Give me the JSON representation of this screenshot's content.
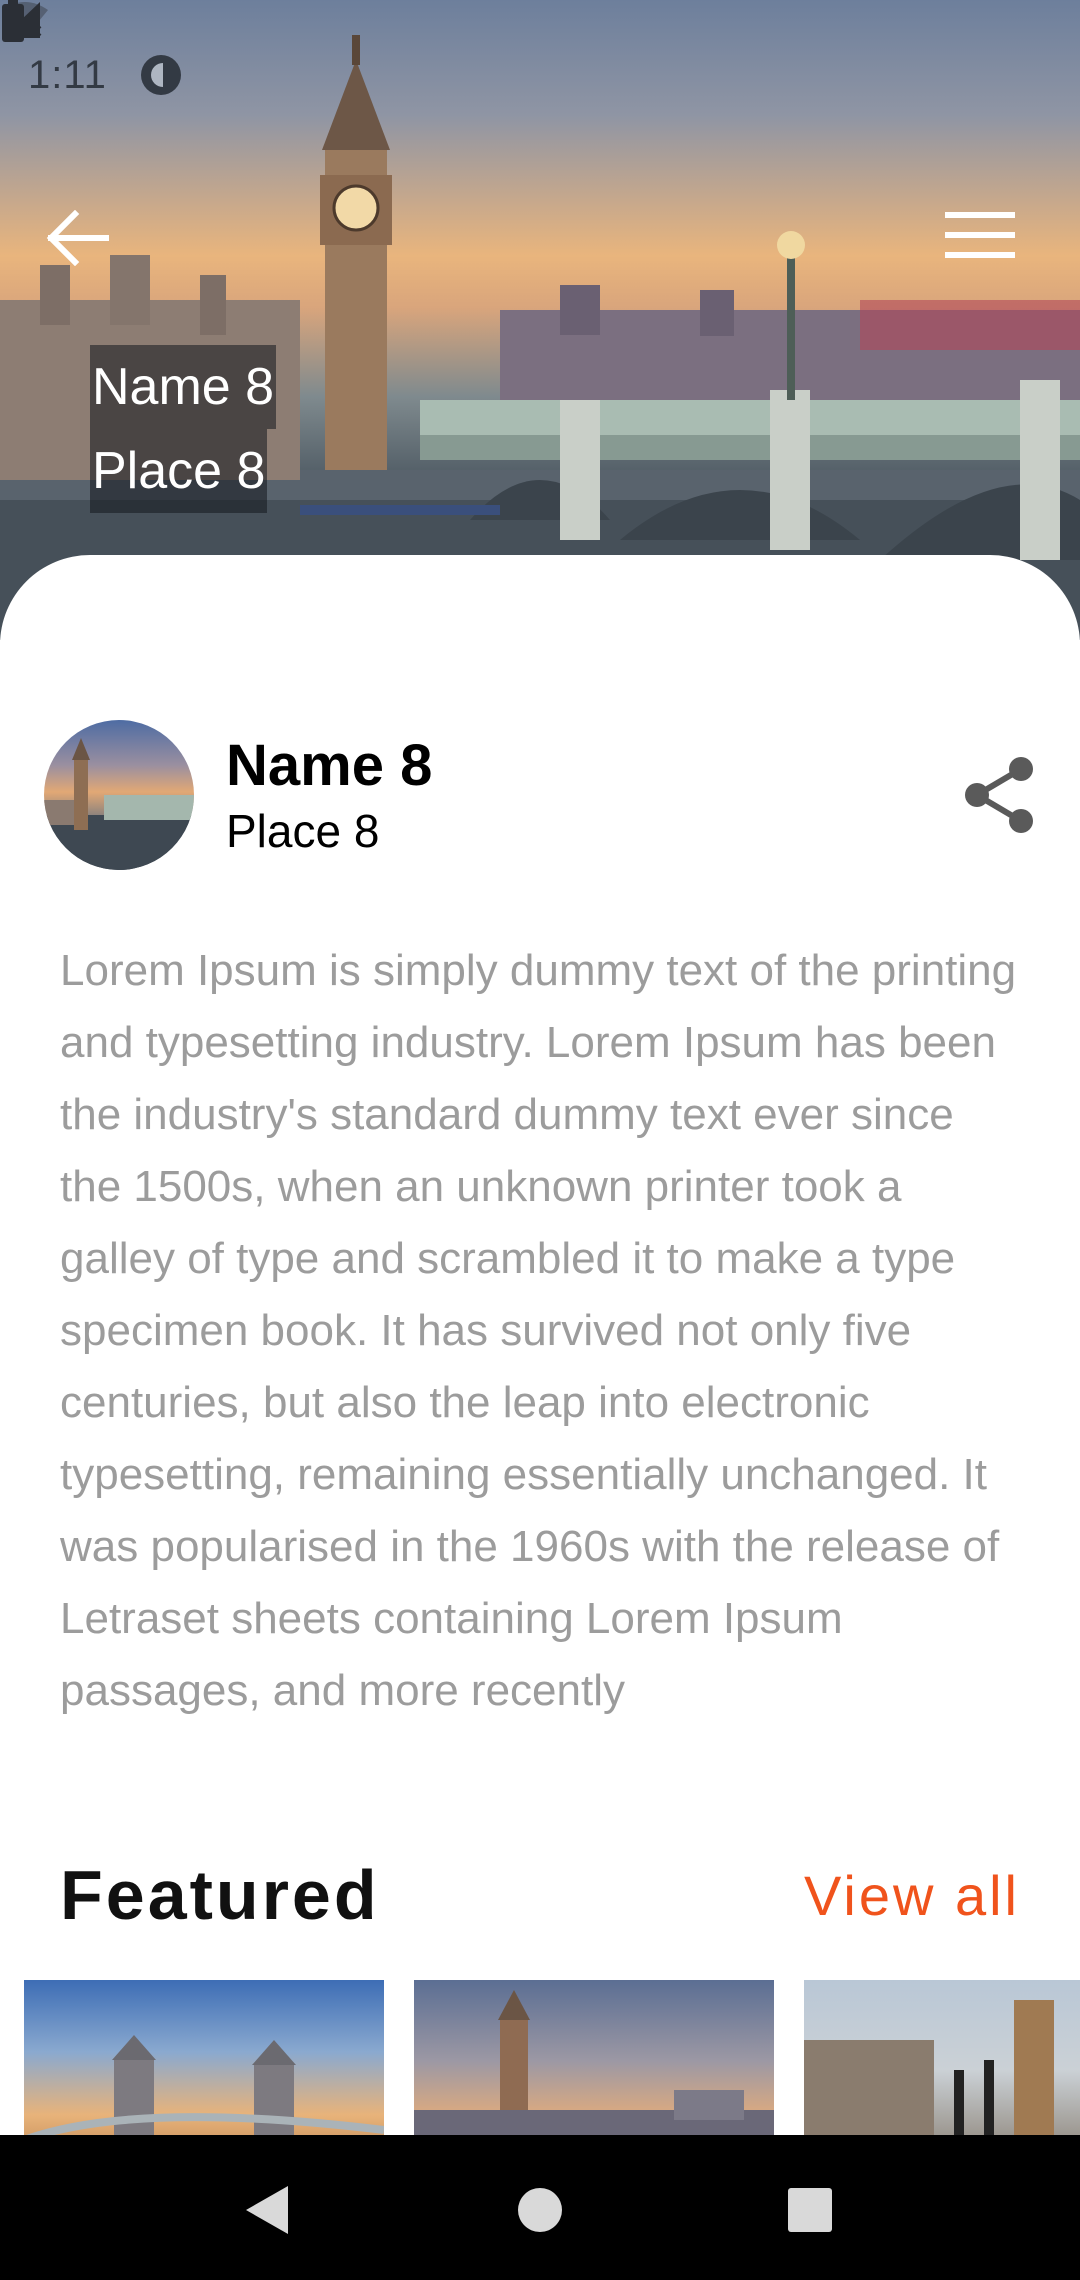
{
  "status_bar": {
    "time": "1:11",
    "icons": [
      "data-saver-icon",
      "wifi-off-icon",
      "signal-icon",
      "battery-icon"
    ]
  },
  "header": {
    "back_icon": "arrow-back-icon",
    "menu_icon": "hamburger-menu-icon",
    "caption_name": "Name 8",
    "caption_place": "Place 8"
  },
  "profile": {
    "name": "Name 8",
    "place": "Place 8",
    "share_icon": "share-icon"
  },
  "description": "Lorem Ipsum is simply dummy text of the printing and typesetting industry. Lorem Ipsum has been the industry's standard dummy text ever since the 1500s, when an unknown printer took a galley of type and scrambled it to make a type specimen book. It has survived not only five centuries, but also the leap into electronic typesetting, remaining essentially unchanged. It was popularised in the 1960s with the release of Letraset sheets containing Lorem Ipsum passages, and more recently",
  "featured": {
    "title": "Featured",
    "view_all_label": "View all"
  },
  "system_nav": {
    "back_icon": "nav-back-triangle-icon",
    "home_icon": "nav-home-circle-icon",
    "recents_icon": "nav-recents-square-icon"
  },
  "colors": {
    "accent": "#f0531c",
    "description_text": "#9c9c9c",
    "nav_bar": "#000000"
  }
}
